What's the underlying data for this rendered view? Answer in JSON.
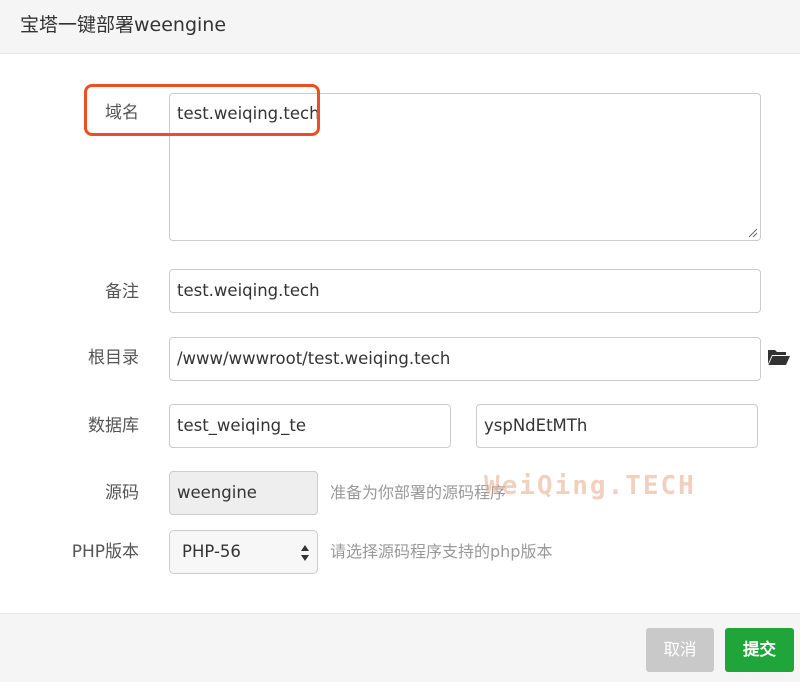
{
  "dialog": {
    "title": "宝塔一键部署weengine"
  },
  "form": {
    "domain": {
      "label": "域名",
      "value": "test.weiqing.tech"
    },
    "remark": {
      "label": "备注",
      "value": "test.weiqing.tech"
    },
    "root": {
      "label": "根目录",
      "value": "/www/wwwroot/test.weiqing.tech",
      "icon": "folder-open-icon"
    },
    "database": {
      "label": "数据库",
      "name": "test_weiqing_te",
      "password": "yspNdEtMTh"
    },
    "source": {
      "label": "源码",
      "value": "weengine",
      "hint": "准备为你部署的源码程序"
    },
    "php": {
      "label": "PHP版本",
      "selected": "PHP-56",
      "hint": "请选择源码程序支持的php版本"
    }
  },
  "watermark": "WeiQing.TECH",
  "colors": {
    "highlight": "#ef4f1e",
    "submit": "#20a53a",
    "cancel": "#c9c9c9"
  },
  "buttons": {
    "cancel": "取消",
    "submit": "提交"
  }
}
